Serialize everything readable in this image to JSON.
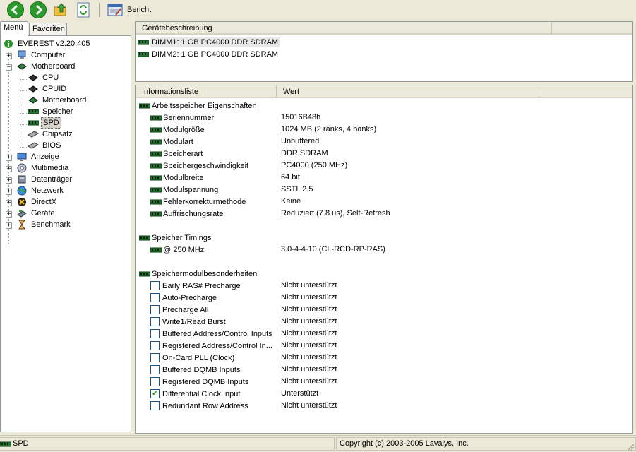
{
  "toolbar": {
    "report_label": "Bericht",
    "icons": [
      "back-icon",
      "forward-icon",
      "up-folder-icon",
      "refresh-icon",
      "report-icon"
    ]
  },
  "tabs": [
    {
      "label": "Menü",
      "active": true
    },
    {
      "label": "Favoriten",
      "active": false
    }
  ],
  "tree": {
    "root": "EVEREST v2.20.405",
    "items": [
      {
        "label": "Computer"
      },
      {
        "label": "Motherboard"
      },
      {
        "label": "CPU"
      },
      {
        "label": "CPUID"
      },
      {
        "label": "Motherboard"
      },
      {
        "label": "Speicher"
      },
      {
        "label": "SPD",
        "selected": true
      },
      {
        "label": "Chipsatz"
      },
      {
        "label": "BIOS"
      },
      {
        "label": "Anzeige"
      },
      {
        "label": "Multimedia"
      },
      {
        "label": "Datenträger"
      },
      {
        "label": "Netzwerk"
      },
      {
        "label": "DirectX"
      },
      {
        "label": "Geräte"
      },
      {
        "label": "Benchmark"
      }
    ]
  },
  "devices": {
    "header": "Gerätebeschreibung",
    "items": [
      "DIMM1: 1 GB PC4000 DDR SDRAM",
      "DIMM2: 1 GB PC4000 DDR SDRAM"
    ]
  },
  "info": {
    "col_name": "Informationsliste",
    "col_value": "Wert",
    "sections": [
      {
        "title": "Arbeitsspeicher Eigenschaften",
        "rows": [
          {
            "name": "Seriennummer",
            "value": "15016B48h"
          },
          {
            "name": "Modulgröße",
            "value": "1024 MB (2 ranks, 4 banks)"
          },
          {
            "name": "Modulart",
            "value": "Unbuffered"
          },
          {
            "name": "Speicherart",
            "value": "DDR SDRAM"
          },
          {
            "name": "Speichergeschwindigkeit",
            "value": "PC4000 (250 MHz)"
          },
          {
            "name": "Modulbreite",
            "value": "64 bit"
          },
          {
            "name": "Modulspannung",
            "value": "SSTL 2.5"
          },
          {
            "name": "Fehlerkorrekturmethode",
            "value": "Keine"
          },
          {
            "name": "Auffrischungsrate",
            "value": "Reduziert (7.8 us), Self-Refresh"
          }
        ]
      },
      {
        "title": "Speicher Timings",
        "rows": [
          {
            "name": "@ 250 MHz",
            "value": "3.0-4-4-10  (CL-RCD-RP-RAS)"
          }
        ]
      },
      {
        "title": "Speichermodulbesonderheiten",
        "checks": [
          {
            "name": "Early RAS# Precharge",
            "value": "Nicht unterstützt",
            "checked": false
          },
          {
            "name": "Auto-Precharge",
            "value": "Nicht unterstützt",
            "checked": false
          },
          {
            "name": "Precharge All",
            "value": "Nicht unterstützt",
            "checked": false
          },
          {
            "name": "Write1/Read Burst",
            "value": "Nicht unterstützt",
            "checked": false
          },
          {
            "name": "Buffered Address/Control Inputs",
            "value": "Nicht unterstützt",
            "checked": false
          },
          {
            "name": "Registered Address/Control In...",
            "value": "Nicht unterstützt",
            "checked": false
          },
          {
            "name": "On-Card PLL (Clock)",
            "value": "Nicht unterstützt",
            "checked": false
          },
          {
            "name": "Buffered DQMB Inputs",
            "value": "Nicht unterstützt",
            "checked": false
          },
          {
            "name": "Registered DQMB Inputs",
            "value": "Nicht unterstützt",
            "checked": false
          },
          {
            "name": "Differential Clock Input",
            "value": "Unterstützt",
            "checked": true
          },
          {
            "name": "Redundant Row Address",
            "value": "Nicht unterstützt",
            "checked": false
          }
        ]
      }
    ]
  },
  "status": {
    "left": "SPD",
    "right": "Copyright (c) 2003-2005 Lavalys, Inc."
  }
}
